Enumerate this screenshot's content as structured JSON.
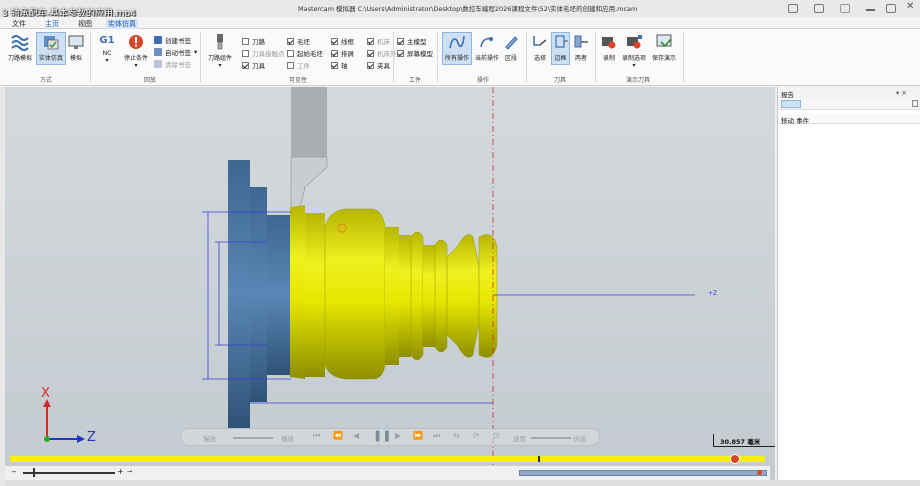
{
  "video_title": "3 轴承配车-基本参数的应用.mp4",
  "titlebar": {
    "title": "Mastercam 模拟器  C:\\Users\\Administrator\\Desktop\\数控车编程2026课程文件\\52\\实体毛坯的创建和应用.mcam"
  },
  "menu": {
    "items": [
      "文件",
      "主页",
      "视图",
      "实体仿真"
    ],
    "active_index": 3
  },
  "ribbon": {
    "mode_group": {
      "label": "方式",
      "buttons": [
        "刀路模拟",
        "实体仿真",
        "模拟"
      ]
    },
    "playback_group": {
      "label": "回放",
      "g1": "G1",
      "nc": "NC",
      "stop_label": "停止条件",
      "items": [
        "创建书签",
        "自动书签",
        "清除书签"
      ]
    },
    "visibility_group": {
      "label": "可见性",
      "tool_group_label": "刀路组件",
      "checkboxes": [
        {
          "label": "刀路",
          "checked": false,
          "dim": false
        },
        {
          "label": "毛坯",
          "checked": true,
          "dim": false
        },
        {
          "label": "线框",
          "checked": true,
          "dim": false
        },
        {
          "label": "机床",
          "checked": true,
          "dim": true
        },
        {
          "label": "刀具接触点",
          "checked": false,
          "dim": true
        },
        {
          "label": "起始毛坯",
          "checked": false,
          "dim": false
        },
        {
          "label": "排屑",
          "checked": true,
          "dim": false
        },
        {
          "label": "机床外壳",
          "checked": true,
          "dim": true
        },
        {
          "label": "刀具",
          "checked": true,
          "dim": false
        },
        {
          "label": "工件",
          "checked": false,
          "dim": true
        },
        {
          "label": "轴",
          "checked": true,
          "dim": false
        },
        {
          "label": "夹具",
          "checked": true,
          "dim": false
        }
      ]
    },
    "workpiece_group": {
      "label": "工件",
      "checkboxes": [
        {
          "label": "主模型",
          "checked": true
        },
        {
          "label": "屏幕模型",
          "checked": true
        }
      ]
    },
    "operation_group": {
      "label": "操作",
      "buttons": [
        "所有操作",
        "当前操作",
        "区段"
      ]
    },
    "tool_group": {
      "label": "刀具",
      "buttons": [
        "选择",
        "边框",
        "两者"
      ]
    },
    "demo_group": {
      "label": "演示刀具",
      "buttons": [
        "录制",
        "录制选项",
        "保存演示"
      ]
    }
  },
  "report_panel": {
    "title": "报告",
    "pin_label": "▾ ✕",
    "columns": "移动 事件"
  },
  "viewport": {
    "axis_x": "X",
    "axis_z": "Z",
    "z_marker": "+Z",
    "scale_label": "30.857 毫米"
  },
  "playbar": {
    "labels": [
      "慢放",
      "播放",
      "速度",
      "快速"
    ]
  },
  "colors": {
    "part_yellow": "#e3e300",
    "chuck_blue": "#4f7aa6",
    "dim_line": "#3b3bd6",
    "axis_red": "#d42a2a",
    "axis_blue": "#1c38c8",
    "progress_yellow": "#f5ee1c",
    "highlight_tab": "#1b56b3"
  },
  "progress": 0.96
}
